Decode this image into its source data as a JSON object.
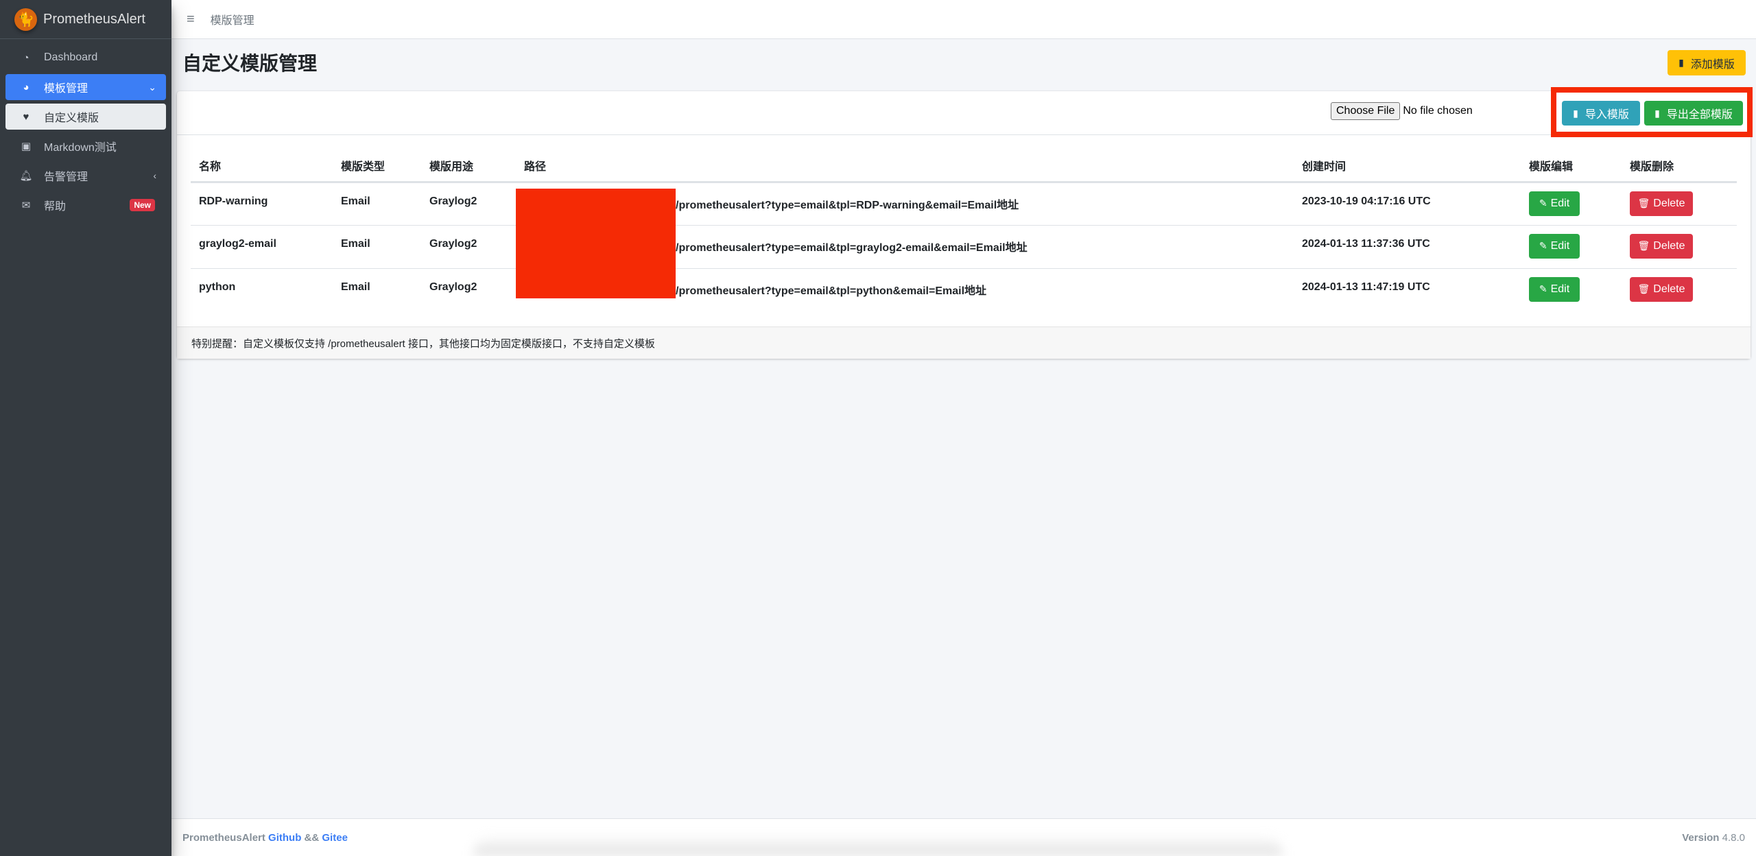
{
  "brand": {
    "name": "PrometheusAlert",
    "logo_icon": "prometheus-logo-icon"
  },
  "sidebar": {
    "items": [
      {
        "label": "Dashboard",
        "icon": "dashboard-gauge-icon",
        "icon_glyph": "◔"
      },
      {
        "label": "模板管理",
        "icon": "pie-chart-icon",
        "icon_glyph": "◕",
        "right": "⌄",
        "active": true
      },
      {
        "label": "自定义模版",
        "icon": "heart-icon",
        "icon_glyph": "♥",
        "sub_active": true
      },
      {
        "label": "Markdown测试",
        "icon": "image-icon",
        "icon_glyph": "▣"
      },
      {
        "label": "告警管理",
        "icon": "bell-icon",
        "icon_glyph": "🔔",
        "right": "‹"
      },
      {
        "label": "帮助",
        "icon": "envelope-icon",
        "icon_glyph": "✉",
        "badge": "New"
      }
    ]
  },
  "topnav": {
    "menu_glyph": "≡",
    "link": "模版管理"
  },
  "page": {
    "title": "自定义模版管理",
    "add_button": "添加模版",
    "file_input": {
      "button": "Choose File",
      "status": "No file chosen"
    },
    "import_button": "导入模版",
    "export_button": "导出全部模版",
    "file_glyph": "▮"
  },
  "table": {
    "headers": [
      "名称",
      "模版类型",
      "模版用途",
      "路径",
      "创建时间",
      "模版编辑",
      "模版删除"
    ],
    "rows": [
      {
        "name": "RDP-warning",
        "type": "Email",
        "purpose": "Graylog2",
        "path": "/prometheusalert?type=email&tpl=RDP-warning&email=Email地址",
        "created": "2023-10-19 04:17:16 UTC",
        "edit": "Edit",
        "delete": "Delete"
      },
      {
        "name": "graylog2-email",
        "type": "Email",
        "purpose": "Graylog2",
        "path": "/prometheusalert?type=email&tpl=graylog2-email&email=Email地址",
        "created": "2024-01-13 11:37:36 UTC",
        "edit": "Edit",
        "delete": "Delete"
      },
      {
        "name": "python",
        "type": "Email",
        "purpose": "Graylog2",
        "path": "/prometheusalert?type=email&tpl=python&email=Email地址",
        "created": "2024-01-13 11:47:19 UTC",
        "edit": "Edit",
        "delete": "Delete"
      }
    ],
    "edit_glyph": "✎",
    "delete_glyph": "🗑"
  },
  "note": "特别提醒：自定义模板仅支持 /prometheusalert 接口，其他接口均为固定模版接口，不支持自定义模板",
  "footer": {
    "brand": "PrometheusAlert",
    "github": "Github",
    "sep": "&&",
    "gitee": "Gitee",
    "version_label": "Version",
    "version": "4.8.0"
  },
  "colors": {
    "sidebar_bg": "#343a40",
    "primary": "#3c7ef5",
    "warning": "#ffc107",
    "info": "#30a2b8",
    "success": "#28a745",
    "danger": "#dc3545",
    "highlight": "#f52a05"
  }
}
